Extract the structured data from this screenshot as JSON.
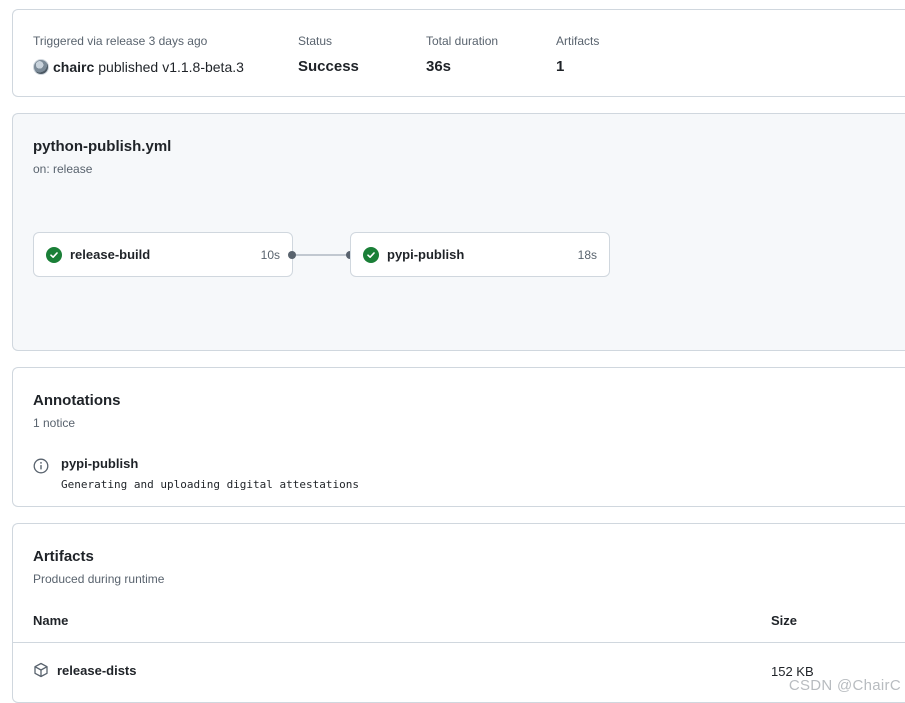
{
  "summary": {
    "trigger_label": "Triggered via release 3 days ago",
    "actor": "chairc",
    "action": "published",
    "release_tag": "v1.1.8-beta.3",
    "status_label": "Status",
    "status_value": "Success",
    "duration_label": "Total duration",
    "duration_value": "36s",
    "artifacts_label": "Artifacts",
    "artifacts_value": "1"
  },
  "workflow": {
    "file": "python-publish.yml",
    "trigger": "on: release",
    "jobs": [
      {
        "name": "release-build",
        "duration": "10s",
        "status": "success"
      },
      {
        "name": "pypi-publish",
        "duration": "18s",
        "status": "success"
      }
    ]
  },
  "annotations": {
    "title": "Annotations",
    "count_text": "1 notice",
    "items": [
      {
        "icon": "info-icon",
        "title": "pypi-publish",
        "message": "Generating and uploading digital attestations"
      }
    ]
  },
  "artifacts": {
    "title": "Artifacts",
    "subtitle": "Produced during runtime",
    "col_name": "Name",
    "col_size": "Size",
    "rows": [
      {
        "icon": "package-icon",
        "name": "release-dists",
        "size": "152 KB"
      }
    ]
  },
  "watermark": "CSDN @ChairC",
  "colors": {
    "success": "#1a7f37",
    "muted_text": "#59636e",
    "border": "#d0d7de",
    "graph_bg": "#f6f8fa"
  }
}
